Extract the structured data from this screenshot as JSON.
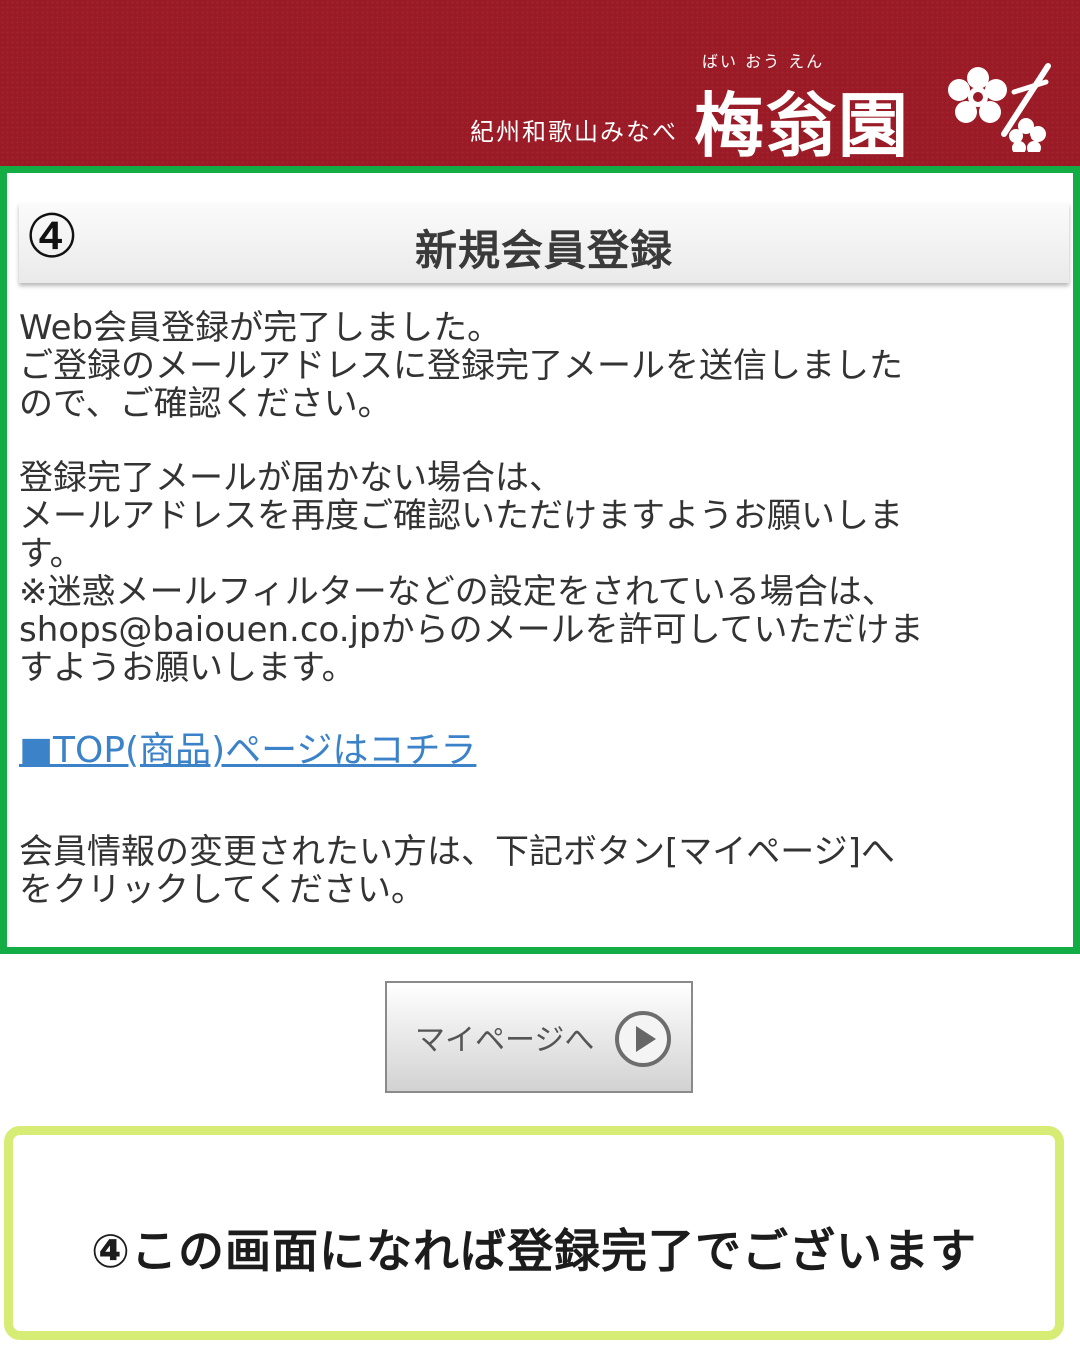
{
  "header": {
    "tagline": "紀州和歌山みなべ",
    "brand_furigana": "ばい おう えん",
    "brand_name": "梅翁園",
    "colors": {
      "background": "#9a1b26",
      "text": "#ffffff"
    }
  },
  "content": {
    "step_marker": "④",
    "title": "新規会員登録",
    "paragraph1": [
      "Web会員登録が完了しました。",
      "ご登録のメールアドレスに登録完了メールを送信しました",
      "ので、ご確認ください。"
    ],
    "paragraph2": [
      "登録完了メールが届かない場合は、",
      "メールアドレスを再度ご確認いただけますようお願いしま",
      "す。",
      "※迷惑メールフィルターなどの設定をされている場合は、",
      "shops@baiouen.co.jpからのメールを許可していただけま",
      "すようお願いします。"
    ],
    "top_link": "■TOP(商品)ページはコチラ",
    "paragraph3": [
      "会員情報の変更されたい方は、下記ボタン[マイページ]へ",
      "をクリックしてください。"
    ],
    "border_color": "#14ad45",
    "link_color": "#3b82c8"
  },
  "mypage_button": {
    "label": "マイページへ",
    "icon": "play-circle-icon"
  },
  "annotation": {
    "text": "④この画面になれば登録完了でございます",
    "border_color": "#d6ec74"
  }
}
